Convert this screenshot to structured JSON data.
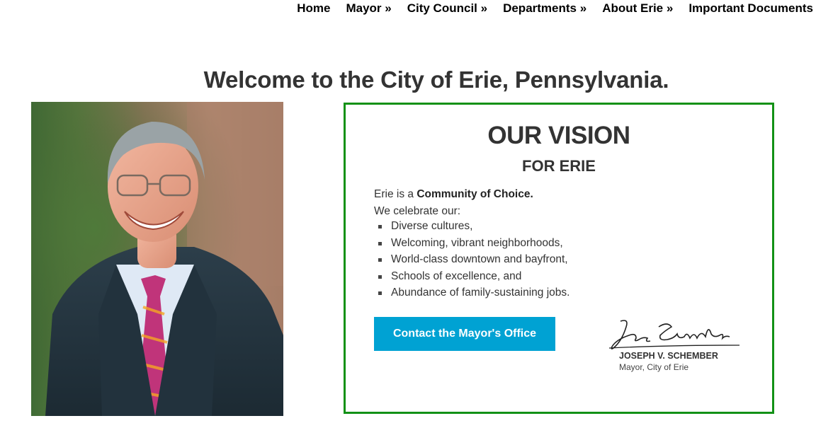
{
  "nav": {
    "items": [
      {
        "label": "Home"
      },
      {
        "label": "Mayor »"
      },
      {
        "label": "City Council »"
      },
      {
        "label": "Departments »"
      },
      {
        "label": "About Erie »"
      },
      {
        "label": "Important Documents"
      }
    ]
  },
  "page": {
    "title": "Welcome to the City of Erie, Pennsylvania."
  },
  "photo": {
    "icon": "mayor-portrait"
  },
  "vision": {
    "heading": "OUR VISION",
    "subheading": "FOR ERIE",
    "intro_prefix": "Erie is a ",
    "intro_bold": "Community of Choice.",
    "celebrate": "We celebrate our:",
    "bullets": [
      "Diverse cultures,",
      "Welcoming, vibrant neighborhoods,",
      "World-class downtown and bayfront,",
      "Schools of excellence, and",
      "Abundance of family-sustaining jobs."
    ],
    "contact_button": "Contact the Mayor's Office",
    "signature_name": "JOSEPH V. SCHEMBER",
    "signature_role": "Mayor, City of Erie",
    "signature_script": "Joe Schember"
  },
  "colors": {
    "border": "#129116",
    "button": "#00a2d3",
    "text": "#333333"
  }
}
